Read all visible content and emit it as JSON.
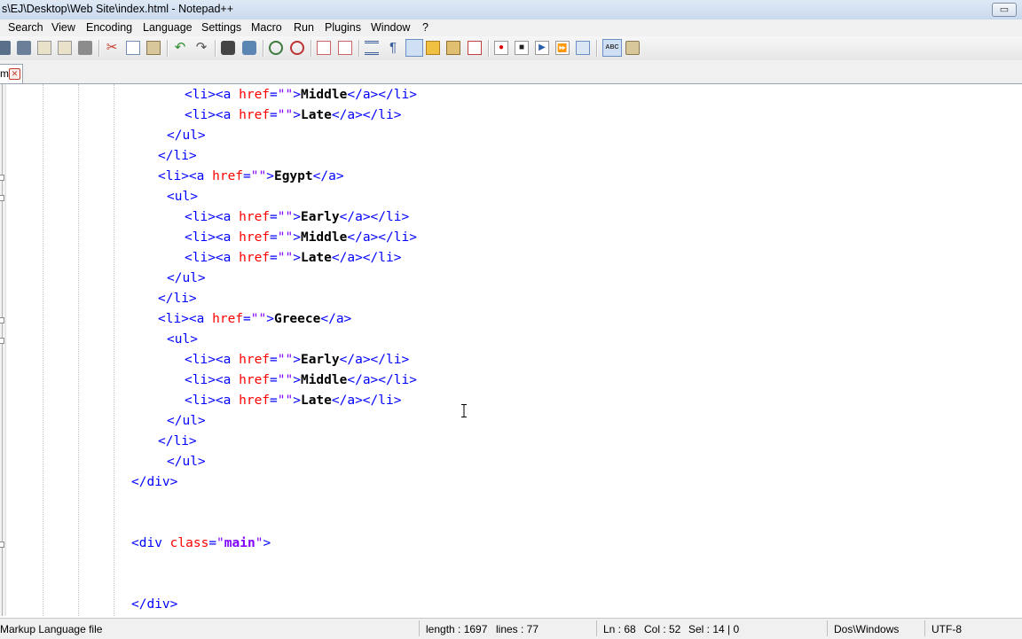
{
  "window": {
    "title": "s\\EJ\\Desktop\\Web Site\\index.html - Notepad++",
    "minimize_glyph": "▭"
  },
  "menu": [
    "Search",
    "View",
    "Encoding",
    "Language",
    "Settings",
    "Macro",
    "Run",
    "Plugins",
    "Window",
    "?"
  ],
  "toolbar": {
    "icons": [
      "save-icon",
      "save-all-icon",
      "close-icon",
      "close-all-icon",
      "print-icon",
      "cut-icon",
      "copy-icon",
      "paste-icon",
      "undo-icon",
      "redo-icon",
      "find-icon",
      "replace-icon",
      "zoom-in-icon",
      "zoom-out-icon",
      "sync-vertical-icon",
      "sync-horizontal-icon",
      "word-wrap-icon",
      "show-all-chars-icon",
      "indent-guide-icon",
      "language-udl-icon",
      "doc-map-icon",
      "function-list-icon",
      "record-macro-icon",
      "stop-macro-icon",
      "play-macro-icon",
      "run-macro-multiple-icon",
      "save-macro-icon",
      "spell-check-icon",
      "spell-options-icon"
    ]
  },
  "tab": {
    "label": "ml",
    "close_glyph": "✕"
  },
  "editor": {
    "lines": [
      [
        {
          "c": "tag",
          "t": "<li><a "
        },
        {
          "c": "attr",
          "t": "href"
        },
        {
          "c": "tag",
          "t": "="
        },
        {
          "c": "str",
          "t": "\"\""
        },
        {
          "c": "tag",
          "t": ">"
        },
        {
          "c": "txt",
          "t": "Middle"
        },
        {
          "c": "tag",
          "t": "</a></li>"
        }
      ],
      [
        {
          "c": "tag",
          "t": "<li><a "
        },
        {
          "c": "attr",
          "t": "href"
        },
        {
          "c": "tag",
          "t": "="
        },
        {
          "c": "str",
          "t": "\"\""
        },
        {
          "c": "tag",
          "t": ">"
        },
        {
          "c": "txt",
          "t": "Late"
        },
        {
          "c": "tag",
          "t": "</a></li>"
        }
      ],
      [
        {
          "c": "tag",
          "t": "</ul>"
        }
      ],
      [
        {
          "c": "tag",
          "t": "</li>"
        }
      ],
      [
        {
          "c": "tag",
          "t": "<li><a "
        },
        {
          "c": "attr",
          "t": "href"
        },
        {
          "c": "tag",
          "t": "="
        },
        {
          "c": "str",
          "t": "\"\""
        },
        {
          "c": "tag",
          "t": ">"
        },
        {
          "c": "txt",
          "t": "Egypt"
        },
        {
          "c": "tag",
          "t": "</a>"
        }
      ],
      [
        {
          "c": "tag",
          "t": "<ul>"
        }
      ],
      [
        {
          "c": "tag",
          "t": "<li><a "
        },
        {
          "c": "attr",
          "t": "href"
        },
        {
          "c": "tag",
          "t": "="
        },
        {
          "c": "str",
          "t": "\"\""
        },
        {
          "c": "tag",
          "t": ">"
        },
        {
          "c": "txt",
          "t": "Early"
        },
        {
          "c": "tag",
          "t": "</a></li>"
        }
      ],
      [
        {
          "c": "tag",
          "t": "<li><a "
        },
        {
          "c": "attr",
          "t": "href"
        },
        {
          "c": "tag",
          "t": "="
        },
        {
          "c": "str",
          "t": "\"\""
        },
        {
          "c": "tag",
          "t": ">"
        },
        {
          "c": "txt",
          "t": "Middle"
        },
        {
          "c": "tag",
          "t": "</a></li>"
        }
      ],
      [
        {
          "c": "tag",
          "t": "<li><a "
        },
        {
          "c": "attr",
          "t": "href"
        },
        {
          "c": "tag",
          "t": "="
        },
        {
          "c": "str",
          "t": "\"\""
        },
        {
          "c": "tag",
          "t": ">"
        },
        {
          "c": "txt",
          "t": "Late"
        },
        {
          "c": "tag",
          "t": "</a></li>"
        }
      ],
      [
        {
          "c": "tag",
          "t": "</ul>"
        }
      ],
      [
        {
          "c": "tag",
          "t": "</li>"
        }
      ],
      [
        {
          "c": "tag",
          "t": "<li><a "
        },
        {
          "c": "attr",
          "t": "href"
        },
        {
          "c": "tag",
          "t": "="
        },
        {
          "c": "str",
          "t": "\"\""
        },
        {
          "c": "tag",
          "t": ">"
        },
        {
          "c": "txt",
          "t": "Greece"
        },
        {
          "c": "tag",
          "t": "</a>"
        }
      ],
      [
        {
          "c": "tag",
          "t": "<ul>"
        }
      ],
      [
        {
          "c": "tag",
          "t": "<li><a "
        },
        {
          "c": "attr",
          "t": "href"
        },
        {
          "c": "tag",
          "t": "="
        },
        {
          "c": "str",
          "t": "\"\""
        },
        {
          "c": "tag",
          "t": ">"
        },
        {
          "c": "txt",
          "t": "Early"
        },
        {
          "c": "tag",
          "t": "</a></li>"
        }
      ],
      [
        {
          "c": "tag",
          "t": "<li><a "
        },
        {
          "c": "attr",
          "t": "href"
        },
        {
          "c": "tag",
          "t": "="
        },
        {
          "c": "str",
          "t": "\"\""
        },
        {
          "c": "tag",
          "t": ">"
        },
        {
          "c": "txt",
          "t": "Middle"
        },
        {
          "c": "tag",
          "t": "</a></li>"
        }
      ],
      [
        {
          "c": "tag",
          "t": "<li><a "
        },
        {
          "c": "attr",
          "t": "href"
        },
        {
          "c": "tag",
          "t": "="
        },
        {
          "c": "str",
          "t": "\"\""
        },
        {
          "c": "tag",
          "t": ">"
        },
        {
          "c": "txt",
          "t": "Late"
        },
        {
          "c": "tag",
          "t": "</a></li>"
        }
      ],
      [
        {
          "c": "tag",
          "t": "</ul>"
        }
      ],
      [
        {
          "c": "tag",
          "t": "</li>"
        }
      ],
      [
        {
          "c": "tag",
          "t": "</ul>"
        }
      ],
      [
        {
          "c": "tag",
          "t": "</div>"
        }
      ],
      [],
      [],
      [
        {
          "c": "tag",
          "t": "<div "
        },
        {
          "c": "attr",
          "t": "class"
        },
        {
          "c": "tag",
          "t": "="
        },
        {
          "c": "str",
          "t": "\""
        },
        {
          "c": "cls",
          "t": "main"
        },
        {
          "c": "str",
          "t": "\""
        },
        {
          "c": "tag",
          "t": ">"
        }
      ],
      [],
      [],
      [
        {
          "c": "tag",
          "t": "</div>"
        }
      ]
    ]
  },
  "status": {
    "file_type": "Markup Language file",
    "length": "length : 1697",
    "lines": "lines : 77",
    "ln": "Ln : 68",
    "col": "Col : 52",
    "sel": "Sel : 14 | 0",
    "eol": "Dos\\Windows",
    "encoding": "UTF-8"
  },
  "colors": {
    "tag": "#0000ff",
    "attribute": "#ff0000",
    "string": "#8000ff",
    "text": "#000000"
  }
}
